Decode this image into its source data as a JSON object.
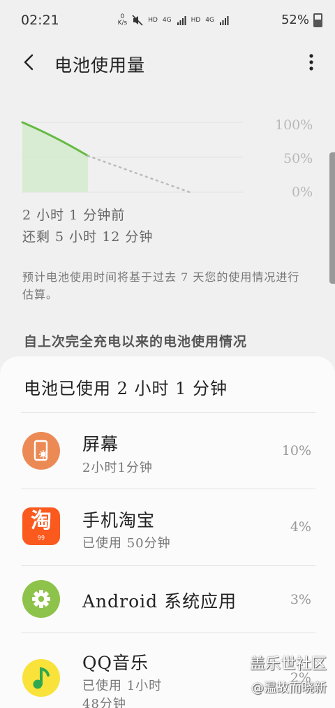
{
  "status_bar": {
    "time": "02:21",
    "net_speed_value": "0",
    "net_speed_unit": "K/s",
    "hd1": "HD",
    "lte1": "4G",
    "hd2": "HD",
    "lte2": "4G",
    "battery_pct": "52%"
  },
  "header": {
    "title": "电池使用量"
  },
  "chart": {
    "label_100": "100%",
    "label_50": "50%",
    "label_0": "0%"
  },
  "chart_data": {
    "type": "area",
    "x": [
      0,
      1
    ],
    "series": [
      {
        "values": [
          100,
          52
        ]
      }
    ],
    "projection": {
      "x": [
        1,
        2.55
      ],
      "values": [
        52,
        0
      ]
    },
    "ylim": [
      0,
      100
    ],
    "ytick_labels": [
      "100%",
      "50%",
      "0%"
    ]
  },
  "info": {
    "since": "2 小时 1 分钟前",
    "remaining": "还剩 5 小时 12 分钟",
    "note": "预计电池使用时间将基于过去 7 天您的使用情况进行估算。",
    "section_title": "自上次完全充电以来的电池使用情况"
  },
  "sheet": {
    "title": "电池已使用 2 小时 1 分钟",
    "apps": [
      {
        "name": "屏幕",
        "sub": "2小时1分钟",
        "pct": "10%",
        "icon": "screen-icon",
        "color": "#ec8a55"
      },
      {
        "name": "手机淘宝",
        "sub": "已使用 50分钟",
        "pct": "4%",
        "icon": "taobao-icon",
        "icon_text": "淘",
        "icon_sub": "99",
        "color": "#fb5a1f"
      },
      {
        "name": "Android 系统应用",
        "sub": "",
        "pct": "3%",
        "icon": "gear-icon",
        "color": "#8dc34a"
      },
      {
        "name": "QQ音乐",
        "sub": "已使用 1小时",
        "sub2": "48分钟",
        "pct": "2%",
        "icon": "qq-music-icon",
        "color": "#f9e23a"
      }
    ]
  },
  "watermark": {
    "line1": "盖乐世社区",
    "line2": "@温故而晓新"
  }
}
